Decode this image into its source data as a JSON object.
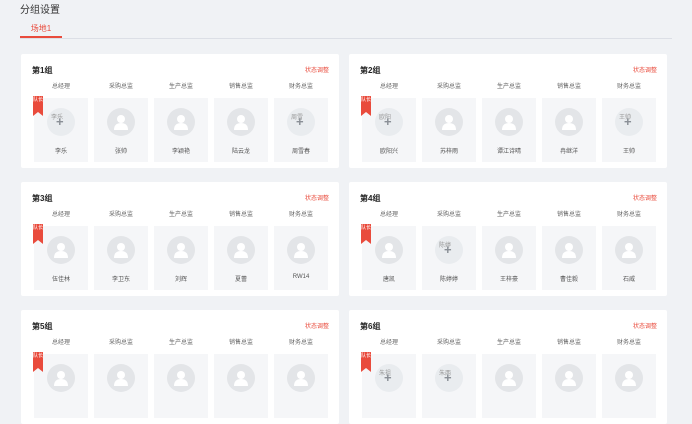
{
  "page_title": "分组设置",
  "tabs": [
    {
      "label": "场地1",
      "active": true
    }
  ],
  "colors": {
    "accent": "#e94b3c",
    "background": "#f0f2f5",
    "card": "#ffffff"
  },
  "roles": [
    "总经理",
    "采购总监",
    "生产总监",
    "销售总监",
    "财务总监"
  ],
  "leader_badge": "队长",
  "action_label": "状态调整",
  "groups": [
    {
      "name": "第1组",
      "members": [
        {
          "name": "李乐",
          "avatar_alt": "李乐",
          "leader": true,
          "broken": true
        },
        {
          "name": "张帅",
          "leader": false,
          "broken": false
        },
        {
          "name": "李颖艳",
          "leader": false,
          "broken": false
        },
        {
          "name": "陆云龙",
          "leader": false,
          "broken": false
        },
        {
          "name": "周雪春",
          "avatar_alt": "周雪",
          "leader": false,
          "broken": true
        }
      ]
    },
    {
      "name": "第2组",
      "members": [
        {
          "name": "欧阳兴",
          "avatar_alt": "欧阳",
          "leader": true,
          "broken": true
        },
        {
          "name": "苏梓雨",
          "leader": false,
          "broken": false
        },
        {
          "name": "谭江诗晴",
          "leader": false,
          "broken": false
        },
        {
          "name": "冉继洋",
          "leader": false,
          "broken": false
        },
        {
          "name": "王帅",
          "avatar_alt": "王帅",
          "leader": false,
          "broken": true
        }
      ]
    },
    {
      "name": "第3组",
      "members": [
        {
          "name": "伍佳林",
          "leader": true,
          "broken": false
        },
        {
          "name": "李卫东",
          "leader": false,
          "broken": false
        },
        {
          "name": "刘辉",
          "leader": false,
          "broken": false
        },
        {
          "name": "夏蕾",
          "leader": false,
          "broken": false
        },
        {
          "name": "RW14",
          "leader": false,
          "broken": false
        }
      ]
    },
    {
      "name": "第4组",
      "members": [
        {
          "name": "唐凯",
          "leader": true,
          "broken": false
        },
        {
          "name": "陈婷婷",
          "avatar_alt": "陈婷",
          "leader": false,
          "broken": true
        },
        {
          "name": "王梓豪",
          "leader": false,
          "broken": false
        },
        {
          "name": "曹佳毅",
          "leader": false,
          "broken": false
        },
        {
          "name": "石威",
          "leader": false,
          "broken": false
        }
      ]
    },
    {
      "name": "第5组",
      "members": [
        {
          "name": "",
          "leader": true,
          "broken": false
        },
        {
          "name": "",
          "leader": false,
          "broken": false
        },
        {
          "name": "",
          "leader": false,
          "broken": false
        },
        {
          "name": "",
          "leader": false,
          "broken": false
        },
        {
          "name": "",
          "leader": false,
          "broken": false
        }
      ]
    },
    {
      "name": "第6组",
      "members": [
        {
          "name": "",
          "avatar_alt": "朱祖",
          "leader": true,
          "broken": true
        },
        {
          "name": "",
          "avatar_alt": "朱两",
          "leader": false,
          "broken": true
        },
        {
          "name": "",
          "leader": false,
          "broken": false
        },
        {
          "name": "",
          "leader": false,
          "broken": false
        },
        {
          "name": "",
          "leader": false,
          "broken": false
        }
      ]
    }
  ]
}
